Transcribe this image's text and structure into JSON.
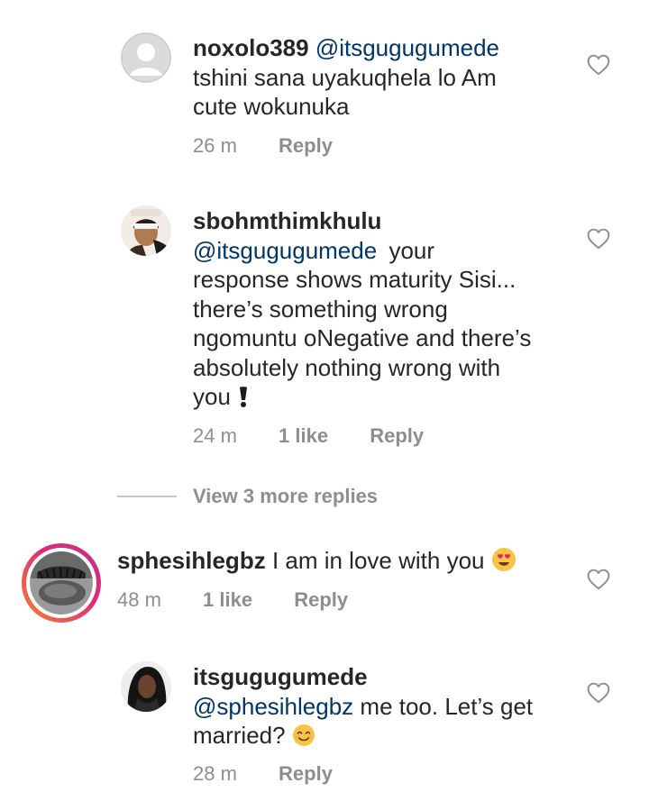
{
  "comments": [
    {
      "username": "noxolo389",
      "mention": "@itsgugugumede",
      "text_lines": [
        "tshini sana uyakuqhela lo Am",
        "cute wokunuka"
      ],
      "time": "26 m",
      "likes": "",
      "reply": "Reply"
    },
    {
      "username": "sbohmthimkhulu",
      "mention": "@itsgugugumede",
      "text_lines": [
        "your",
        "response shows maturity Sisi...",
        "there’s something wrong",
        "ngomuntu oNegative and there’s",
        "absolutely nothing wrong with",
        "you"
      ],
      "time": "24 m",
      "likes": "1 like",
      "reply": "Reply"
    },
    {
      "username": "sphesihlegbz",
      "text": "I am in love with you",
      "time": "48 m",
      "likes": "1 like",
      "reply": "Reply"
    },
    {
      "username": "itsgugugumede",
      "mention": "@sphesihlegbz",
      "text_lines": [
        "me too. Let’s get",
        "married?"
      ],
      "time": "28 m",
      "likes": "",
      "reply": "Reply"
    }
  ],
  "view_more": "View 3 more replies",
  "icons": {
    "like": "heart-outline-icon",
    "avatar_placeholder": "default-avatar-icon",
    "exclamation": "heavy-exclamation-icon",
    "heart_eyes": "heart-eyes-emoji",
    "smile": "smiling-face-emoji"
  },
  "colors": {
    "text": "#262626",
    "mention": "#003569",
    "meta": "#8e8e8e",
    "story_ring_start": "#f58529",
    "story_ring_end": "#dd2a7b"
  }
}
